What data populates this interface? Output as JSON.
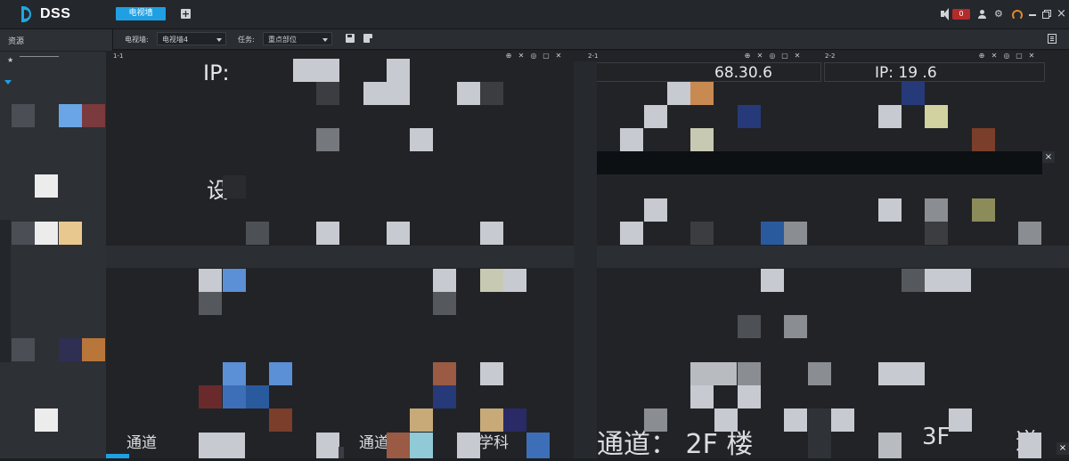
{
  "app": {
    "logo_text": "DSS"
  },
  "header": {
    "active_tab": "电视墙",
    "add_tab_symbol": "+",
    "alarm_count": "0",
    "icons": [
      "speaker-icon",
      "user-icon",
      "gear-icon",
      "speed-icon",
      "minimize-icon",
      "restore-icon",
      "close-icon"
    ]
  },
  "sidebar": {
    "title": "资源",
    "star": "★"
  },
  "toolbar": {
    "wall_label": "电视墙:",
    "wall_value": "电视墙4",
    "task_label": "任务:",
    "task_value": "重点部位"
  },
  "screens": [
    {
      "id": "1-1",
      "icons": [
        "⊕",
        "✕",
        "◎",
        "▢",
        "✕"
      ]
    },
    {
      "id": "2-1",
      "icons": [
        "⊕",
        "✕",
        "◎",
        "▢",
        "✕"
      ]
    },
    {
      "id": "2-2",
      "icons": [
        "⊕",
        "✕",
        "◎",
        "▢",
        "✕"
      ]
    }
  ],
  "overlays": {
    "ip_top_left": "IP:",
    "ip_center": "68.30.6",
    "ip_right": "IP:  19        .6",
    "mid_left": "设",
    "bottom_1": "通道",
    "bottom_2": "通道",
    "bottom_3": "学科",
    "bottom_4": "通道：  2F    楼",
    "bottom_5": "3F",
    "bottom_6": "道"
  },
  "band_close": "×",
  "colors": {
    "accent": "#1ea0e3",
    "alarm": "#b52a2a",
    "background": "#222326"
  }
}
